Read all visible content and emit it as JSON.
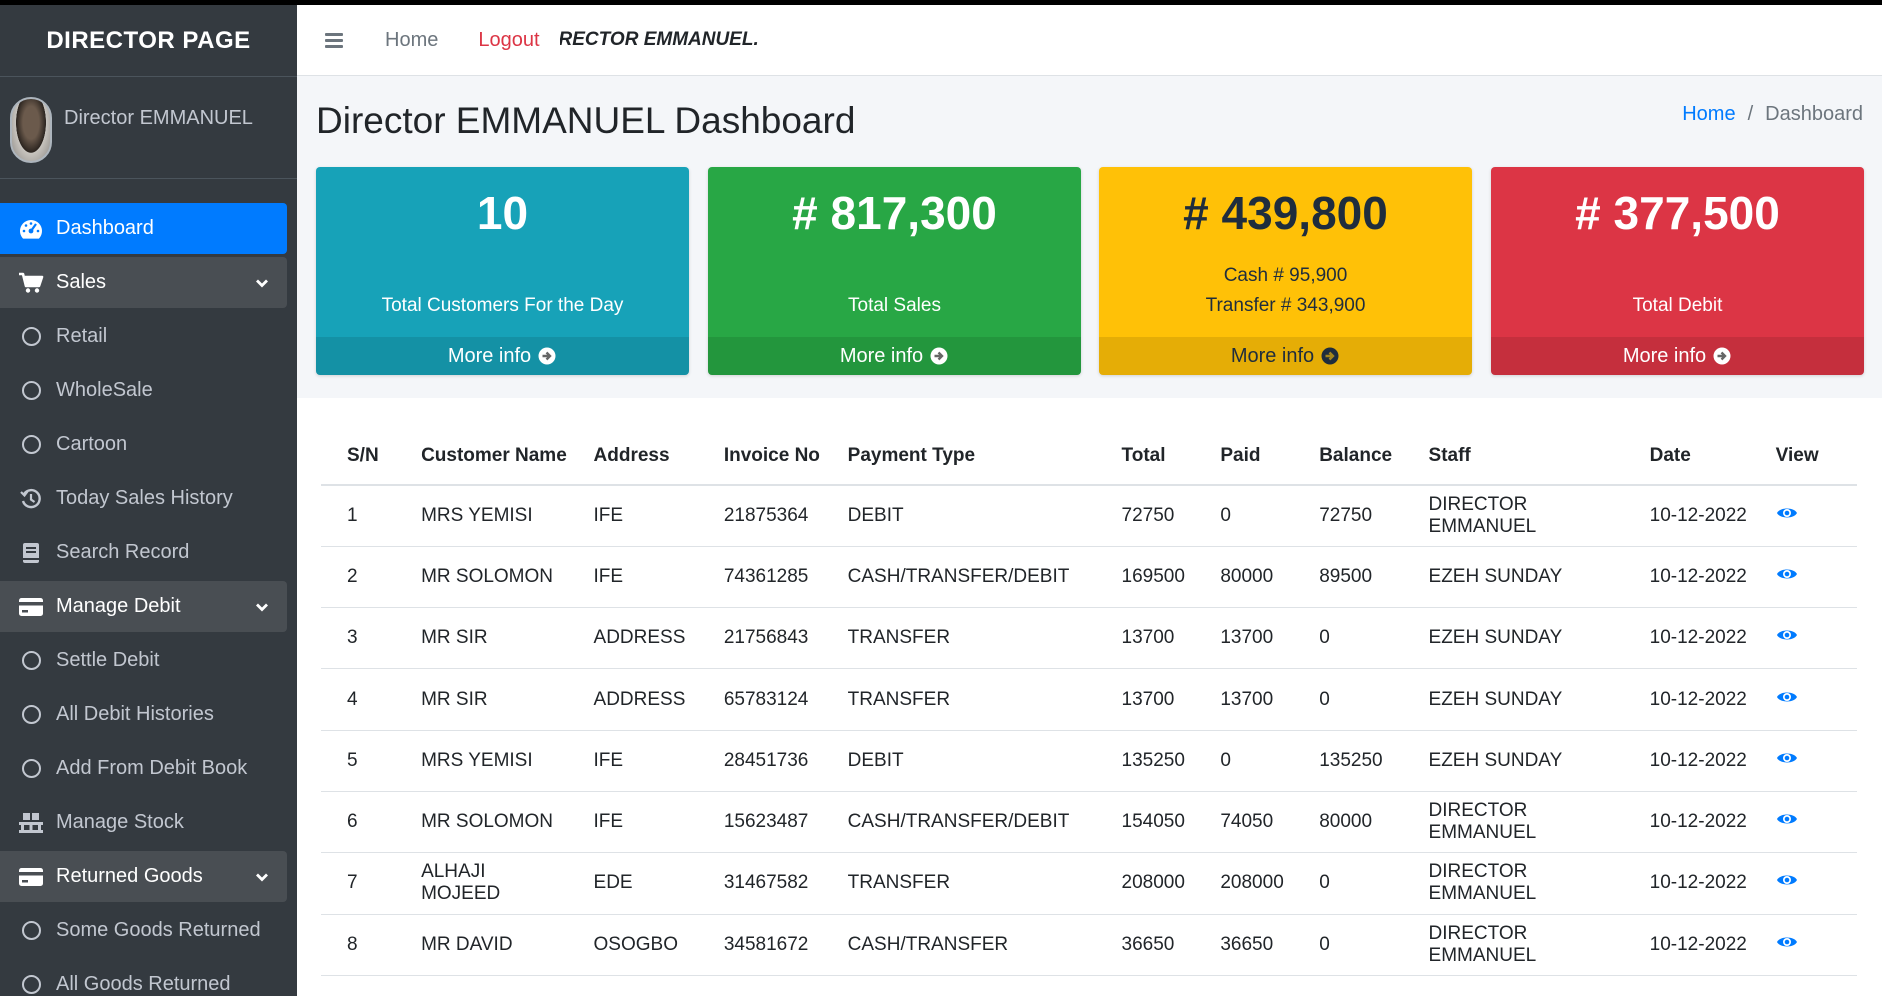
{
  "sidebar": {
    "brand": "DIRECTOR PAGE",
    "user_name": "Director EMMANUEL",
    "items": [
      {
        "label": "Dashboard",
        "icon": "tachometer-icon",
        "state": "active"
      },
      {
        "label": "Sales",
        "icon": "cart-icon",
        "state": "open"
      },
      {
        "label": "Retail",
        "icon": "circle-icon"
      },
      {
        "label": "WholeSale",
        "icon": "circle-icon"
      },
      {
        "label": "Cartoon",
        "icon": "circle-icon"
      },
      {
        "label": "Today Sales History",
        "icon": "history-icon"
      },
      {
        "label": "Search Record",
        "icon": "book-icon"
      },
      {
        "label": "Manage Debit",
        "icon": "credit-card-icon",
        "state": "open"
      },
      {
        "label": "Settle Debit",
        "icon": "circle-icon"
      },
      {
        "label": "All Debit Histories",
        "icon": "circle-icon"
      },
      {
        "label": "Add From Debit Book",
        "icon": "circle-icon"
      },
      {
        "label": "Manage Stock",
        "icon": "pallet-icon"
      },
      {
        "label": "Returned Goods",
        "icon": "credit-card-icon",
        "state": "open"
      },
      {
        "label": "Some Goods Returned",
        "icon": "circle-icon"
      },
      {
        "label": "All Goods Returned",
        "icon": "circle-icon"
      }
    ]
  },
  "topbar": {
    "home": "Home",
    "logout": "Logout",
    "marquee": "DIRECTOR EMMANUEL."
  },
  "header": {
    "title": "Director EMMANUEL Dashboard",
    "breadcrumb_home": "Home",
    "breadcrumb_sep": "/",
    "breadcrumb_current": "Dashboard"
  },
  "stats": [
    {
      "value": "10",
      "label": "Total Customers For the Day",
      "more": "More info",
      "color": "#17a2b8"
    },
    {
      "value": "# 817,300",
      "label": "Total Sales",
      "more": "More info",
      "color": "#28a745"
    },
    {
      "value": "# 439,800",
      "label_cash": "Cash # 95,900",
      "label_transfer": "Transfer # 343,900",
      "more": "More info",
      "color": "#ffc107"
    },
    {
      "value": "# 377,500",
      "label": "Total Debit",
      "more": "More info",
      "color": "#dc3545"
    }
  ],
  "table": {
    "headers": [
      "S/N",
      "Customer Name",
      "Address",
      "Invoice No",
      "Payment Type",
      "Total",
      "Paid",
      "Balance",
      "Staff",
      "Date",
      "View"
    ],
    "rows": [
      [
        "1",
        "MRS YEMISI",
        "IFE",
        "21875364",
        "DEBIT",
        "72750",
        "0",
        "72750",
        "DIRECTOR EMMANUEL",
        "10-12-2022"
      ],
      [
        "2",
        "MR SOLOMON",
        "IFE",
        "74361285",
        "CASH/TRANSFER/DEBIT",
        "169500",
        "80000",
        "89500",
        "EZEH SUNDAY",
        "10-12-2022"
      ],
      [
        "3",
        "MR SIR",
        "ADDRESS",
        "21756843",
        "TRANSFER",
        "13700",
        "13700",
        "0",
        "EZEH SUNDAY",
        "10-12-2022"
      ],
      [
        "4",
        "MR SIR",
        "ADDRESS",
        "65783124",
        "TRANSFER",
        "13700",
        "13700",
        "0",
        "EZEH SUNDAY",
        "10-12-2022"
      ],
      [
        "5",
        "MRS YEMISI",
        "IFE",
        "28451736",
        "DEBIT",
        "135250",
        "0",
        "135250",
        "EZEH SUNDAY",
        "10-12-2022"
      ],
      [
        "6",
        "MR SOLOMON",
        "IFE",
        "15623487",
        "CASH/TRANSFER/DEBIT",
        "154050",
        "74050",
        "80000",
        "DIRECTOR EMMANUEL",
        "10-12-2022"
      ],
      [
        "7",
        "ALHAJI MOJEED",
        "EDE",
        "31467582",
        "TRANSFER",
        "208000",
        "208000",
        "0",
        "DIRECTOR EMMANUEL",
        "10-12-2022"
      ],
      [
        "8",
        "MR DAVID",
        "OSOGBO",
        "34581672",
        "CASH/TRANSFER",
        "36650",
        "36650",
        "0",
        "DIRECTOR EMMANUEL",
        "10-12-2022"
      ]
    ],
    "view_icon": "eye-icon",
    "view_color": "#007bff"
  }
}
